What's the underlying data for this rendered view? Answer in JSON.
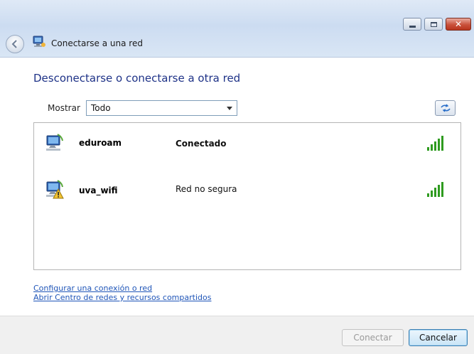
{
  "window": {
    "title": "Conectarse a una red",
    "controls": {
      "minimize_icon": "minimize-icon",
      "maximize_icon": "maximize-icon",
      "close_icon": "close-icon"
    }
  },
  "main": {
    "heading": "Desconectarse o conectarse a otra red",
    "filter": {
      "label": "Mostrar",
      "selected": "Todo"
    },
    "networks": [
      {
        "name": "eduroam",
        "status": "Conectado",
        "status_bold": true,
        "icon": "wireless-network-icon",
        "signal_bars": 5
      },
      {
        "name": "uva_wifi",
        "status": "Red no segura",
        "status_bold": false,
        "icon": "unsecured-network-icon",
        "signal_bars": 5
      }
    ]
  },
  "links": {
    "setup": "Configurar una conexión o red",
    "network_center": "Abrir Centro de redes y recursos compartidos"
  },
  "footer": {
    "connect_label": "Conectar",
    "cancel_label": "Cancelar"
  },
  "colors": {
    "heading": "#1e3287",
    "link": "#1f55b8",
    "signal_green": "#2f9b20"
  }
}
